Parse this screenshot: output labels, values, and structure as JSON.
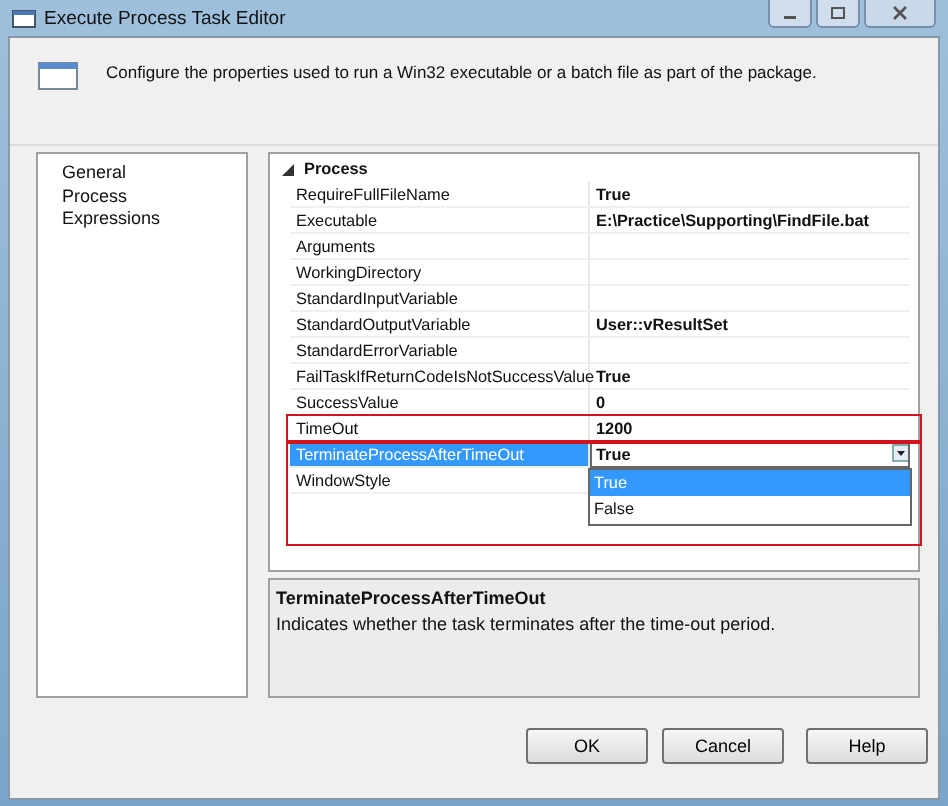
{
  "window": {
    "title": "Execute Process Task Editor"
  },
  "header": {
    "text": "Configure the properties used to run a Win32 executable or a batch file as part of the package."
  },
  "nav": {
    "items": [
      "General",
      "Process",
      "Expressions"
    ]
  },
  "grid": {
    "category": "Process",
    "expanded": true,
    "rows": [
      {
        "name": "RequireFullFileName",
        "value": "True",
        "selected": false
      },
      {
        "name": "Executable",
        "value": "E:\\Practice\\Supporting\\FindFile.bat",
        "selected": false
      },
      {
        "name": "Arguments",
        "value": "",
        "selected": false
      },
      {
        "name": "WorkingDirectory",
        "value": "",
        "selected": false
      },
      {
        "name": "StandardInputVariable",
        "value": "",
        "selected": false
      },
      {
        "name": "StandardOutputVariable",
        "value": "User::vResultSet",
        "selected": false
      },
      {
        "name": "StandardErrorVariable",
        "value": "",
        "selected": false
      },
      {
        "name": "FailTaskIfReturnCodeIsNotSuccessValue",
        "value": "True",
        "selected": false
      },
      {
        "name": "SuccessValue",
        "value": "0",
        "selected": false
      },
      {
        "name": "TimeOut",
        "value": "1200",
        "selected": false
      },
      {
        "name": "TerminateProcessAfterTimeOut",
        "value": "True",
        "selected": true
      },
      {
        "name": "WindowStyle",
        "value": "",
        "selected": false
      }
    ],
    "dropdown": {
      "options": [
        {
          "label": "True",
          "selected": true
        },
        {
          "label": "False",
          "selected": false
        }
      ]
    }
  },
  "description": {
    "title": "TerminateProcessAfterTimeOut",
    "text": "Indicates whether the task terminates after the time-out period."
  },
  "buttons": [
    "OK",
    "Cancel",
    "Help"
  ]
}
